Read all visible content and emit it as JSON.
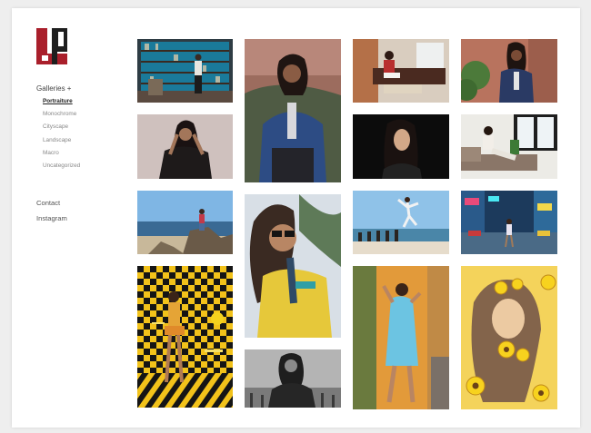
{
  "nav": {
    "galleries_label": "Galleries +",
    "items": [
      {
        "label": "Portraiture"
      },
      {
        "label": "Monochrome"
      },
      {
        "label": "Cityscape"
      },
      {
        "label": "Landscape"
      },
      {
        "label": "Macro"
      },
      {
        "label": "Uncategorized"
      }
    ],
    "contact_label": "Contact",
    "instagram_label": "Instagram"
  },
  "colors": {
    "page_bg": "#eeeeee",
    "panel_bg": "#ffffff",
    "logo_red": "#a91f2b",
    "logo_dark": "#1e1e1e"
  },
  "gallery": {
    "items": [
      {
        "name": "library-portrait"
      },
      {
        "name": "denim-shirt-portrait"
      },
      {
        "name": "loft-sofa-portrait"
      },
      {
        "name": "street-portrait"
      },
      {
        "name": "lace-top-portrait"
      },
      {
        "name": "dark-studio-portrait"
      },
      {
        "name": "window-couch-portrait"
      },
      {
        "name": "rocky-beach-portrait"
      },
      {
        "name": "sunglasses-portrait"
      },
      {
        "name": "pier-leap-portrait"
      },
      {
        "name": "times-square-portrait"
      },
      {
        "name": "checkered-wall-portrait"
      },
      {
        "name": "blue-dress-portrait"
      },
      {
        "name": "sunflower-veil-portrait"
      },
      {
        "name": "monochrome-portrait"
      }
    ]
  }
}
